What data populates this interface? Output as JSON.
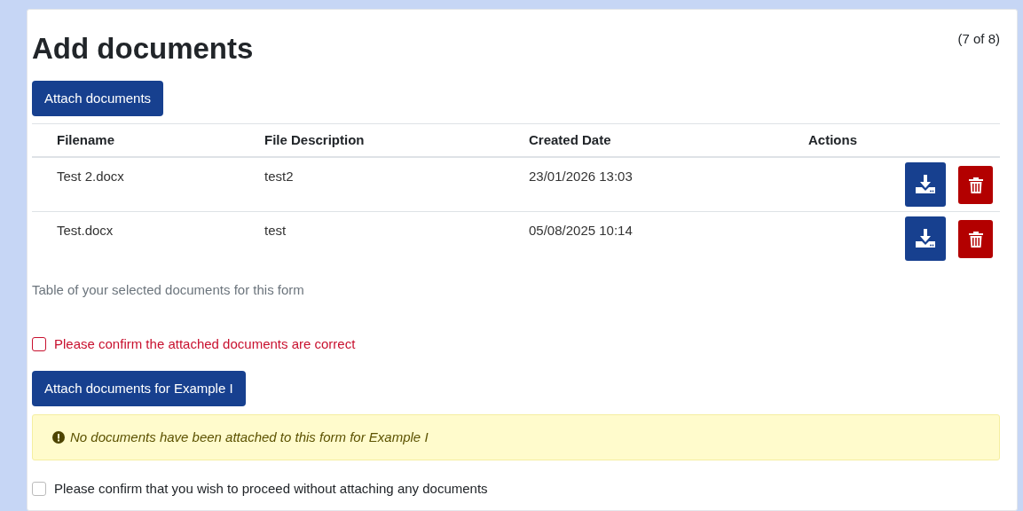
{
  "title": "Add documents",
  "step": "(7 of 8)",
  "attach_button": "Attach documents",
  "table": {
    "columns": [
      "Filename",
      "File Description",
      "Created Date",
      "Actions"
    ],
    "rows": [
      {
        "cells": [
          "Test 2.docx",
          "test2",
          "23/01/2026 13:03"
        ]
      },
      {
        "cells": [
          "Test.docx",
          "test",
          "05/08/2025 10:14"
        ]
      }
    ],
    "caption": "Table of your selected documents for this form"
  },
  "confirm": {
    "label": "Please confirm the attached documents are correct",
    "checked": false,
    "invalid": true
  },
  "attach_for_button": "Attach documents for Example I",
  "alert": {
    "text": "No documents have been attached to this form for Example I"
  },
  "proceed": {
    "label": "Please confirm that you wish to proceed without attaching any documents",
    "checked": false,
    "invalid": false
  }
}
